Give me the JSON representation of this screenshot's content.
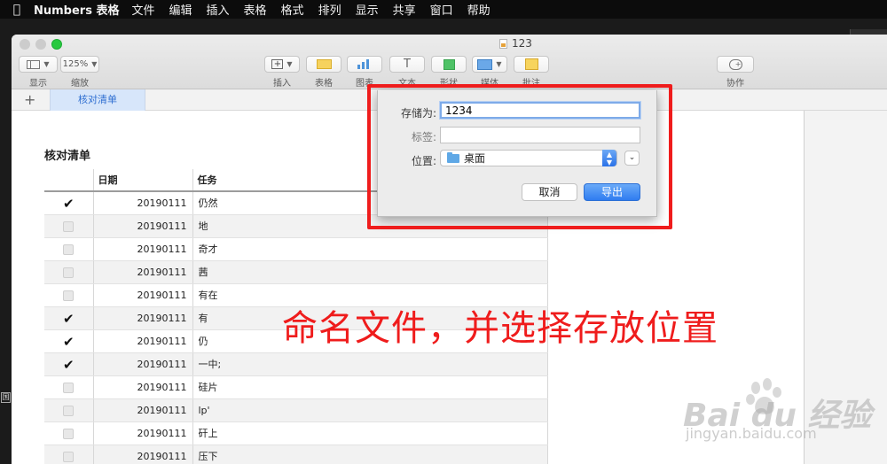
{
  "menubar": {
    "app_name": "Numbers 表格",
    "items": [
      "文件",
      "编辑",
      "插入",
      "表格",
      "格式",
      "排列",
      "显示",
      "共享",
      "窗口",
      "帮助"
    ]
  },
  "window": {
    "title": "123",
    "toolbar": {
      "view_label": "显示",
      "zoom_value": "125%",
      "zoom_label": "缩放",
      "insert_label": "插入",
      "table_label": "表格",
      "chart_label": "图表",
      "text_label": "文本",
      "shape_label": "形状",
      "media_label": "媒体",
      "comment_label": "批注",
      "collaborate_label": "协作"
    },
    "sheet_tab": "核对清单"
  },
  "table": {
    "title": "核对清单",
    "headers": [
      "",
      "日期",
      "任务"
    ],
    "rows": [
      {
        "checked": true,
        "date": "20190111",
        "task": " 仍然"
      },
      {
        "checked": false,
        "date": "20190111",
        "task": "地"
      },
      {
        "checked": false,
        "date": "20190111",
        "task": "奇才"
      },
      {
        "checked": false,
        "date": "20190111",
        "task": "茜"
      },
      {
        "checked": false,
        "date": "20190111",
        "task": "有在"
      },
      {
        "checked": true,
        "date": "20190111",
        "task": "有"
      },
      {
        "checked": true,
        "date": "20190111",
        "task": " 仍"
      },
      {
        "checked": true,
        "date": "20190111",
        "task": " 一中;"
      },
      {
        "checked": false,
        "date": "20190111",
        "task": "硅片"
      },
      {
        "checked": false,
        "date": "20190111",
        "task": "lp'"
      },
      {
        "checked": false,
        "date": "20190111",
        "task": "矸上"
      },
      {
        "checked": false,
        "date": "20190111",
        "task": "压下"
      }
    ]
  },
  "dialog": {
    "save_as_label": "存储为:",
    "save_as_value": "1234",
    "tags_label": "标签:",
    "tags_value": "",
    "location_label": "位置:",
    "location_value": "桌面",
    "cancel_label": "取消",
    "export_label": "导出"
  },
  "annotation": "命名文件，并选择存放位置",
  "watermark": {
    "main": "Bai du 经验",
    "sub": "jingyan.baidu.com"
  },
  "desktop_glyph": "国",
  "colors": {
    "annotation_red": "#ef1c1c",
    "accent_blue": "#2f7cf0",
    "sheet_tab_bg": "#d7e6fa"
  }
}
